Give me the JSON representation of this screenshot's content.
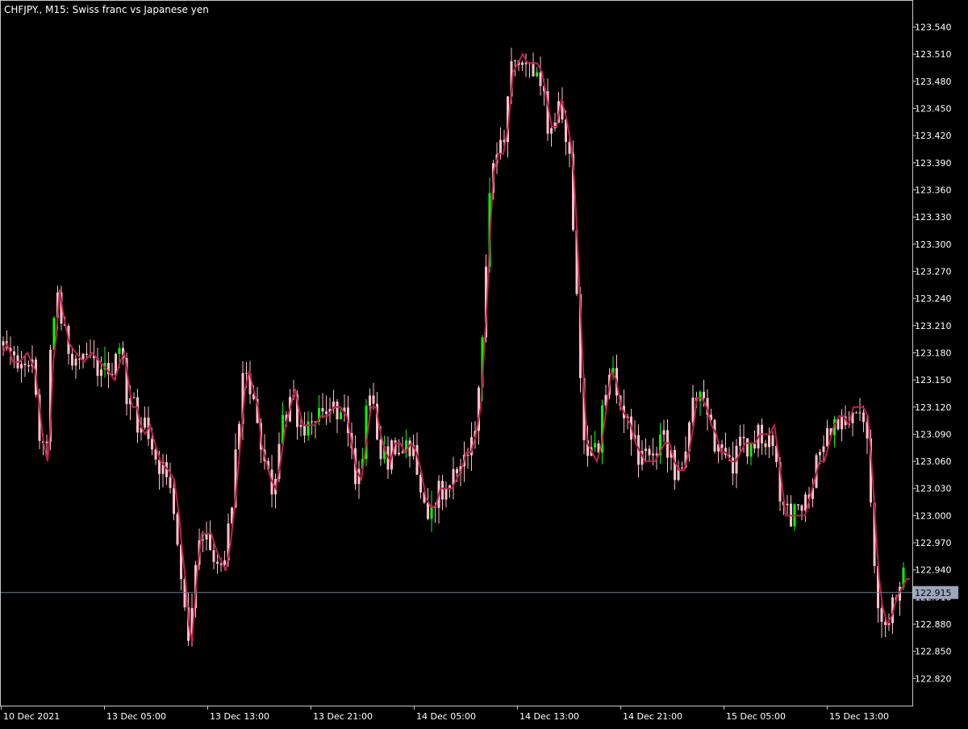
{
  "header": {
    "symbol_label": "CHFJPY., M15:  Swiss franc vs Japanese yen"
  },
  "colors": {
    "background": "#000000",
    "axis": "#c8c8c8",
    "text": "#ffffff",
    "candle_down": "#ffc0cb",
    "candle_up": "#00ff00",
    "ma_line": "#c0204a",
    "price_line": "#6f7f96",
    "price_label_bg": "#9aa7bd",
    "price_label_text": "#000000"
  },
  "chart_data": {
    "type": "candlestick",
    "title": "CHFJPY., M15:  Swiss franc vs Japanese yen",
    "ylim": [
      122.79,
      123.569
    ],
    "y_ticks": [
      "123.540",
      "123.510",
      "123.480",
      "123.450",
      "123.420",
      "123.390",
      "123.360",
      "123.330",
      "123.300",
      "123.270",
      "123.240",
      "123.210",
      "123.180",
      "123.150",
      "123.120",
      "123.090",
      "123.060",
      "123.030",
      "123.000",
      "122.970",
      "122.940",
      "122.910",
      "122.880",
      "122.850",
      "122.820"
    ],
    "x_labels": [
      "10 Dec 2021",
      "13 Dec 05:00",
      "13 Dec 13:00",
      "13 Dec 21:00",
      "14 Dec 05:00",
      "14 Dec 13:00",
      "14 Dec 21:00",
      "15 Dec 05:00",
      "15 Dec 13:00"
    ],
    "current_price": "122.915",
    "close_path": [
      [
        0,
        123.18
      ],
      [
        5,
        123.19
      ],
      [
        12,
        123.17
      ],
      [
        20,
        123.17
      ],
      [
        30,
        123.18
      ],
      [
        40,
        123.16
      ],
      [
        50,
        123.08
      ],
      [
        55,
        123.06
      ],
      [
        58,
        123.09
      ],
      [
        62,
        123.17
      ],
      [
        66,
        123.2
      ],
      [
        70,
        123.25
      ],
      [
        75,
        123.22
      ],
      [
        82,
        123.19
      ],
      [
        90,
        123.18
      ],
      [
        100,
        123.17
      ],
      [
        110,
        123.18
      ],
      [
        120,
        123.17
      ],
      [
        130,
        123.16
      ],
      [
        138,
        123.15
      ],
      [
        145,
        123.17
      ],
      [
        150,
        123.18
      ],
      [
        155,
        123.15
      ],
      [
        160,
        123.12
      ],
      [
        166,
        123.12
      ],
      [
        170,
        123.1
      ],
      [
        176,
        123.09
      ],
      [
        182,
        123.1
      ],
      [
        188,
        123.08
      ],
      [
        195,
        123.06
      ],
      [
        205,
        123.05
      ],
      [
        212,
        123.04
      ],
      [
        218,
        123.0
      ],
      [
        222,
        122.96
      ],
      [
        226,
        122.93
      ],
      [
        230,
        122.88
      ],
      [
        234,
        122.86
      ],
      [
        238,
        122.91
      ],
      [
        242,
        122.95
      ],
      [
        246,
        122.98
      ],
      [
        250,
        122.98
      ],
      [
        258,
        122.98
      ],
      [
        265,
        122.96
      ],
      [
        270,
        122.95
      ],
      [
        276,
        122.94
      ],
      [
        282,
        122.97
      ],
      [
        288,
        123.02
      ],
      [
        292,
        123.06
      ],
      [
        296,
        123.1
      ],
      [
        300,
        123.14
      ],
      [
        305,
        123.16
      ],
      [
        310,
        123.14
      ],
      [
        316,
        123.12
      ],
      [
        320,
        123.08
      ],
      [
        326,
        123.06
      ],
      [
        332,
        123.04
      ],
      [
        338,
        123.03
      ],
      [
        344,
        123.06
      ],
      [
        350,
        123.1
      ],
      [
        356,
        123.12
      ],
      [
        362,
        123.14
      ],
      [
        366,
        123.12
      ],
      [
        372,
        123.1
      ],
      [
        378,
        123.1
      ],
      [
        386,
        123.1
      ],
      [
        394,
        123.11
      ],
      [
        402,
        123.11
      ],
      [
        410,
        123.12
      ],
      [
        418,
        123.12
      ],
      [
        426,
        123.11
      ],
      [
        432,
        123.08
      ],
      [
        438,
        123.05
      ],
      [
        444,
        123.04
      ],
      [
        450,
        123.08
      ],
      [
        456,
        123.12
      ],
      [
        462,
        123.12
      ],
      [
        468,
        123.09
      ],
      [
        474,
        123.07
      ],
      [
        480,
        123.06
      ],
      [
        486,
        123.08
      ],
      [
        492,
        123.08
      ],
      [
        498,
        123.07
      ],
      [
        506,
        123.08
      ],
      [
        512,
        123.07
      ],
      [
        518,
        123.05
      ],
      [
        524,
        123.02
      ],
      [
        530,
        123.01
      ],
      [
        536,
        123.01
      ],
      [
        542,
        123.03
      ],
      [
        550,
        123.03
      ],
      [
        556,
        123.03
      ],
      [
        562,
        123.04
      ],
      [
        568,
        123.05
      ],
      [
        574,
        123.07
      ],
      [
        580,
        123.07
      ],
      [
        586,
        123.09
      ],
      [
        592,
        123.12
      ],
      [
        596,
        123.18
      ],
      [
        600,
        123.24
      ],
      [
        604,
        123.32
      ],
      [
        608,
        123.38
      ],
      [
        614,
        123.4
      ],
      [
        620,
        123.4
      ],
      [
        626,
        123.43
      ],
      [
        632,
        123.49
      ],
      [
        638,
        123.5
      ],
      [
        644,
        123.51
      ],
      [
        650,
        123.5
      ],
      [
        656,
        123.5
      ],
      [
        662,
        123.5
      ],
      [
        668,
        123.49
      ],
      [
        674,
        123.46
      ],
      [
        680,
        123.43
      ],
      [
        686,
        123.43
      ],
      [
        692,
        123.46
      ],
      [
        698,
        123.44
      ],
      [
        704,
        123.41
      ],
      [
        708,
        123.37
      ],
      [
        712,
        123.3
      ],
      [
        716,
        123.22
      ],
      [
        720,
        123.14
      ],
      [
        724,
        123.08
      ],
      [
        730,
        123.07
      ],
      [
        736,
        123.06
      ],
      [
        742,
        123.08
      ],
      [
        748,
        123.12
      ],
      [
        754,
        123.16
      ],
      [
        760,
        123.15
      ],
      [
        766,
        123.12
      ],
      [
        772,
        123.11
      ],
      [
        778,
        123.1
      ],
      [
        784,
        123.08
      ],
      [
        790,
        123.07
      ],
      [
        796,
        123.06
      ],
      [
        802,
        123.06
      ],
      [
        808,
        123.06
      ],
      [
        814,
        123.07
      ],
      [
        820,
        123.08
      ],
      [
        826,
        123.08
      ],
      [
        832,
        123.06
      ],
      [
        838,
        123.05
      ],
      [
        844,
        123.05
      ],
      [
        850,
        123.07
      ],
      [
        856,
        123.1
      ],
      [
        860,
        123.13
      ],
      [
        866,
        123.13
      ],
      [
        872,
        123.12
      ],
      [
        878,
        123.1
      ],
      [
        884,
        123.09
      ],
      [
        890,
        123.07
      ],
      [
        896,
        123.07
      ],
      [
        902,
        123.06
      ],
      [
        908,
        123.06
      ],
      [
        914,
        123.07
      ],
      [
        920,
        123.08
      ],
      [
        926,
        123.08
      ],
      [
        932,
        123.08
      ],
      [
        938,
        123.09
      ],
      [
        944,
        123.09
      ],
      [
        950,
        123.09
      ],
      [
        956,
        123.1
      ],
      [
        962,
        123.06
      ],
      [
        966,
        123.03
      ],
      [
        970,
        123.0
      ],
      [
        976,
        123.0
      ],
      [
        982,
        123.0
      ],
      [
        988,
        123.0
      ],
      [
        994,
        123.0
      ],
      [
        1000,
        123.02
      ],
      [
        1006,
        123.04
      ],
      [
        1012,
        123.06
      ],
      [
        1018,
        123.06
      ],
      [
        1024,
        123.08
      ],
      [
        1030,
        123.1
      ],
      [
        1036,
        123.11
      ],
      [
        1042,
        123.11
      ],
      [
        1048,
        123.1
      ],
      [
        1054,
        123.12
      ],
      [
        1060,
        123.12
      ],
      [
        1066,
        123.12
      ],
      [
        1072,
        123.11
      ],
      [
        1078,
        123.04
      ],
      [
        1082,
        122.98
      ],
      [
        1086,
        122.93
      ],
      [
        1090,
        122.9
      ],
      [
        1096,
        122.88
      ],
      [
        1102,
        122.89
      ],
      [
        1108,
        122.91
      ],
      [
        1114,
        122.92
      ],
      [
        1120,
        122.93
      ],
      [
        1124,
        122.93
      ]
    ]
  }
}
